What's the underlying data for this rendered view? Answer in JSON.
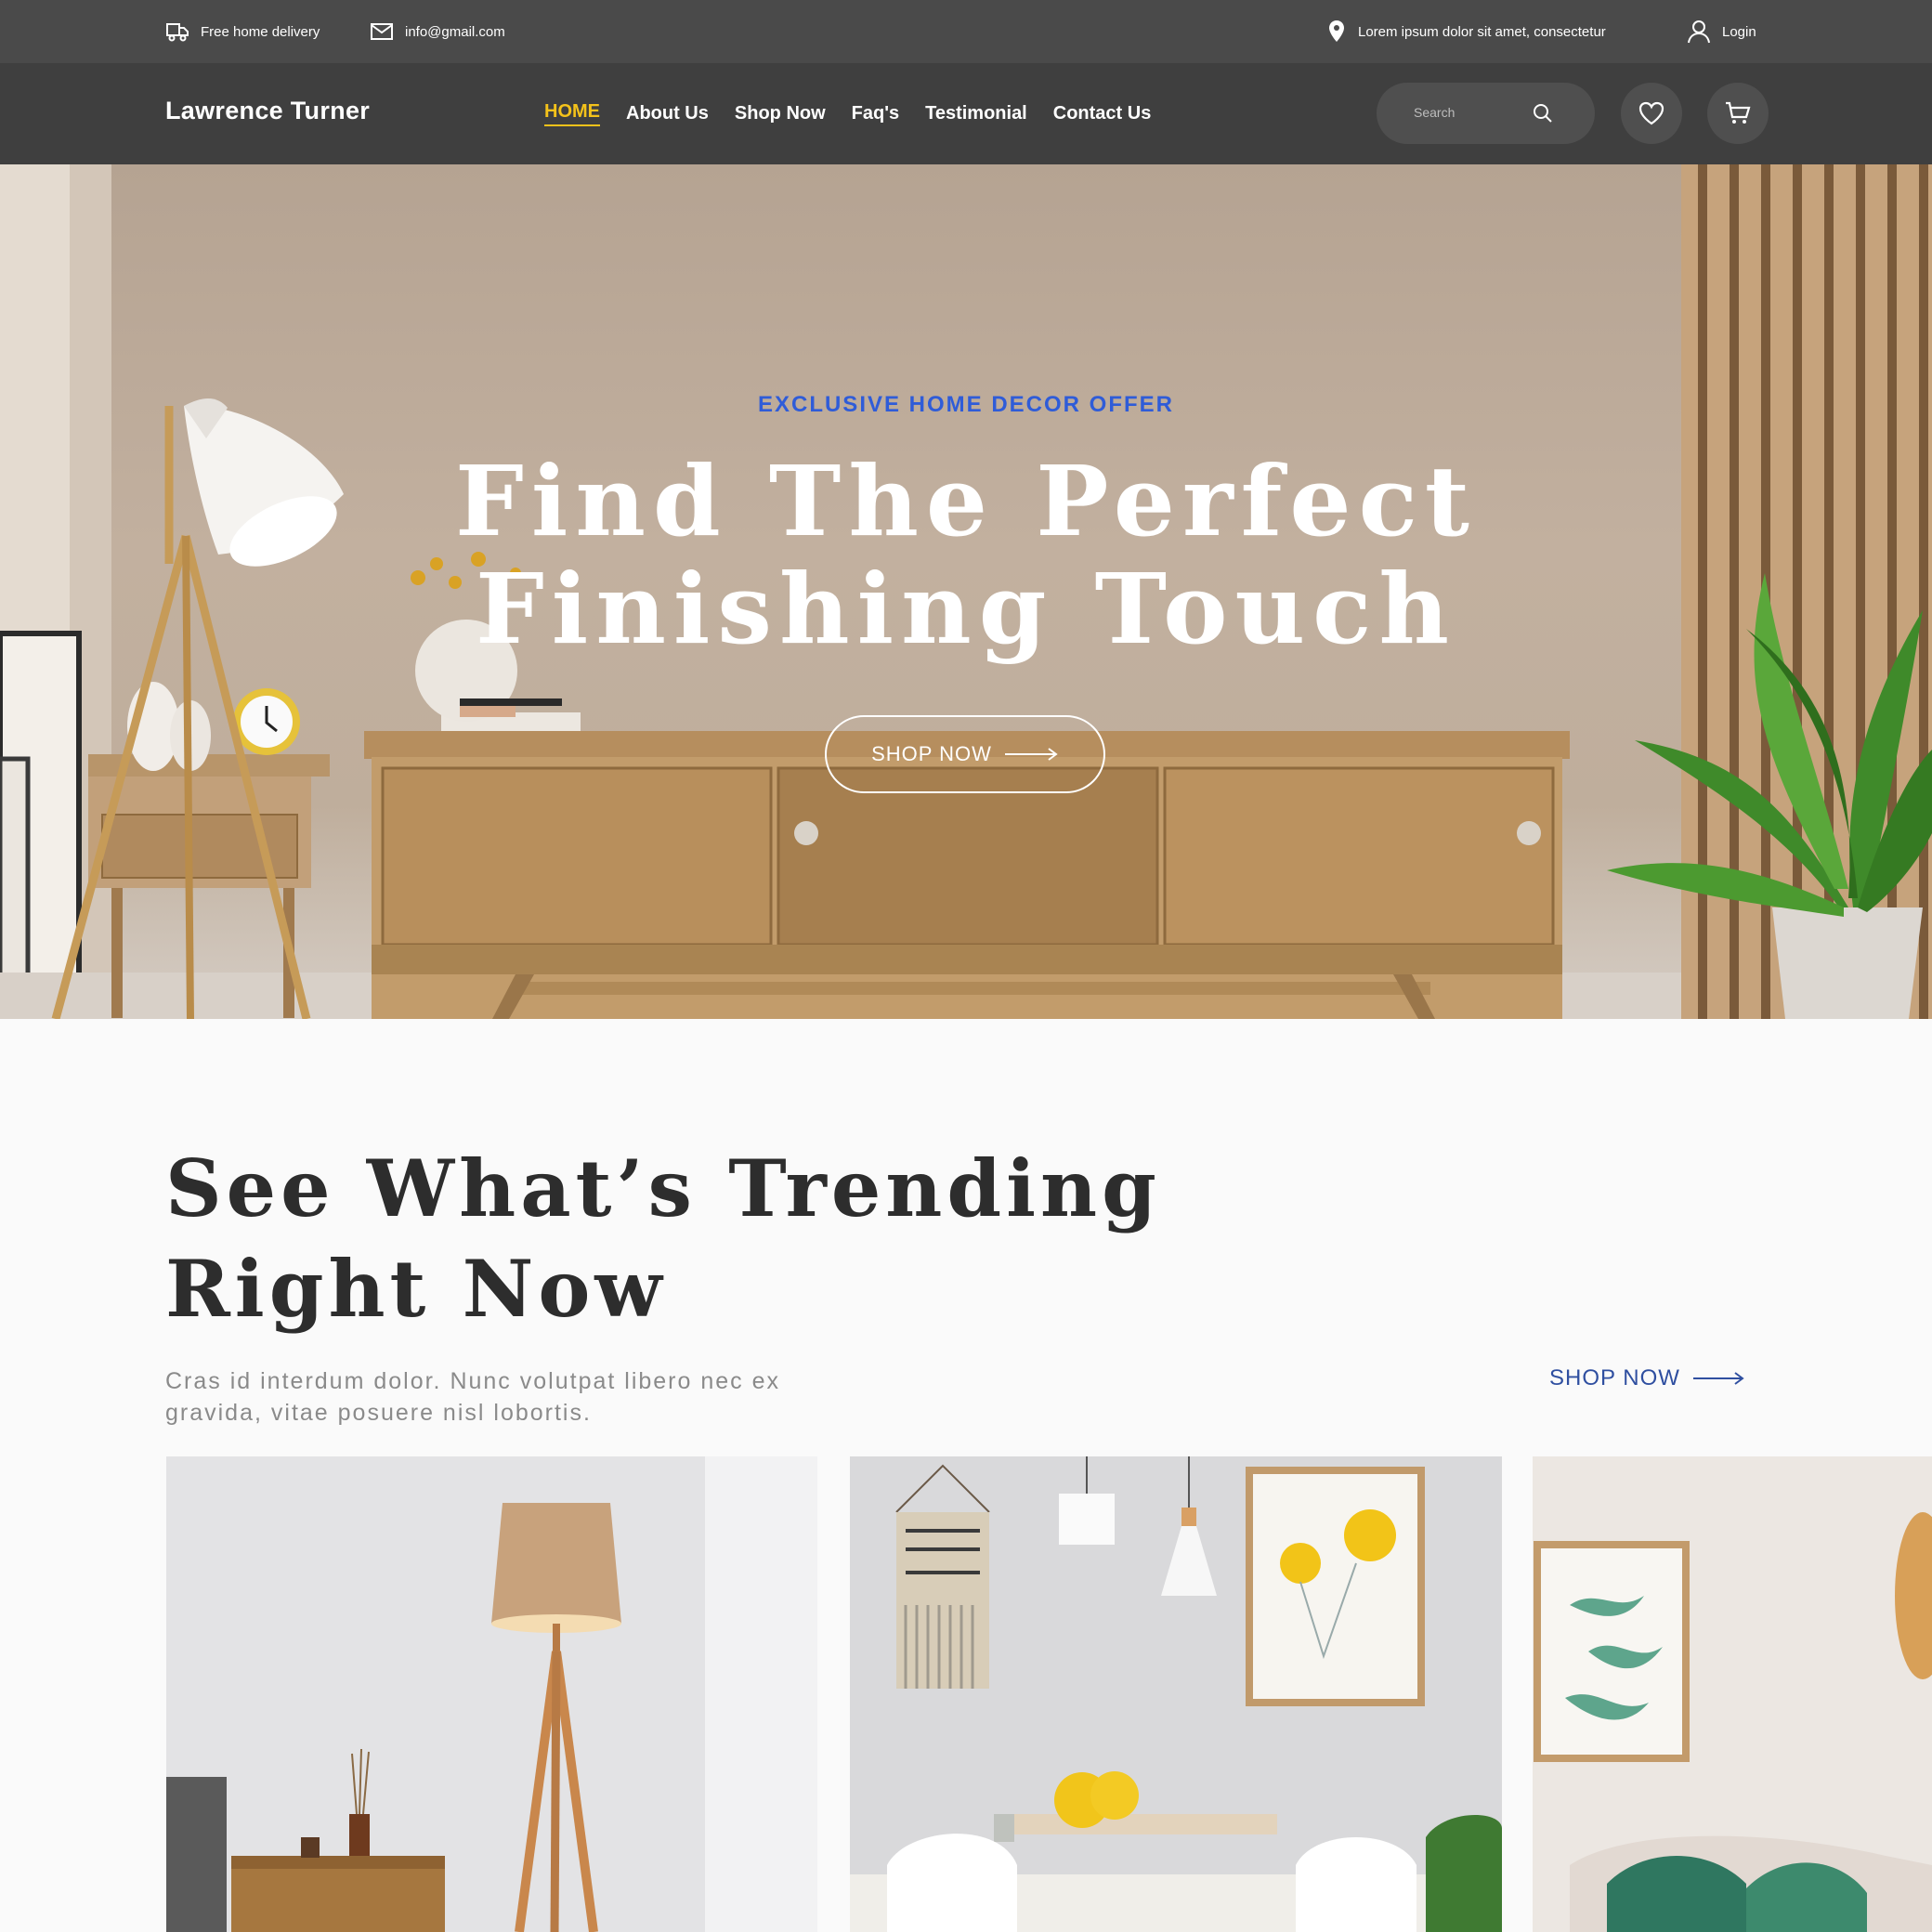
{
  "topbar": {
    "delivery_text": "Free home delivery",
    "email_text": "info@gmail.com",
    "location_text": "Lorem ipsum dolor sit amet, consectetur",
    "login_text": "Login"
  },
  "nav": {
    "brand": "Lawrence Turner",
    "links": [
      "HOME",
      "About Us",
      "Shop Now",
      "Faq's",
      "Testimonial",
      "Contact Us"
    ],
    "active_link": "HOME",
    "search_placeholder": "Search",
    "icons": {
      "search": "search-icon",
      "wishlist": "heart-icon",
      "cart": "cart-icon",
      "user": "user-icon",
      "location": "location-pin-icon",
      "email": "mail-icon",
      "delivery": "truck-icon"
    }
  },
  "hero": {
    "eyebrow": "EXCLUSIVE HOME DECOR OFFER",
    "title_line1": "Find The Perfect",
    "title_line2": "Finishing Touch",
    "button_label": "SHOP NOW"
  },
  "trending": {
    "title_line1": "See What’s Trending",
    "title_line2": "Right Now",
    "description": "Cras id interdum dolor. Nunc volutpat libero nec ex gravida, vitae posuere nisl lobortis.",
    "link_label": "SHOP NOW"
  },
  "colors": {
    "topbar_bg": "#4a4a4a",
    "navbar_bg": "#3f3f3f",
    "accent_yellow": "#f4c21a",
    "eyebrow_blue": "#2f5cd8",
    "link_blue": "#2f4fa0"
  }
}
